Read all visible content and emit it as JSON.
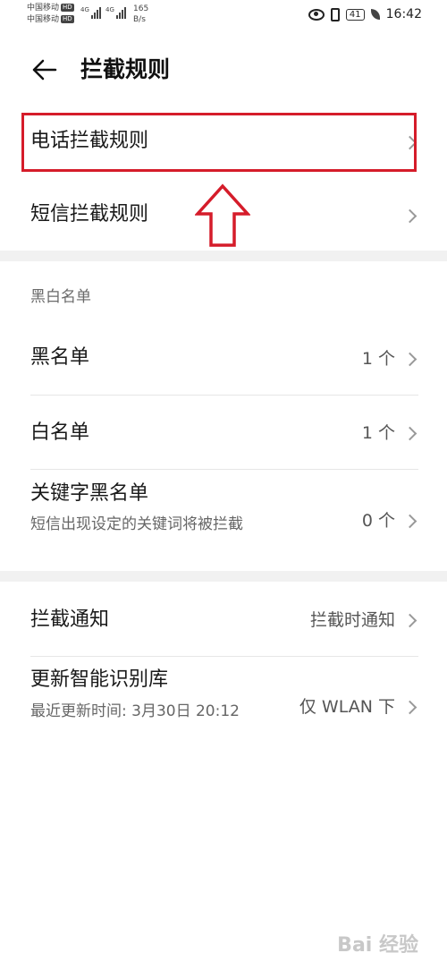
{
  "status_bar": {
    "carrier_1": "中国移动",
    "carrier_2": "中国移动",
    "hd_badge": "HD",
    "network_1": "4G",
    "network_2": "4G",
    "speed_value": "165",
    "speed_unit": "B/s",
    "battery": "41",
    "time": "16:42"
  },
  "header": {
    "title": "拦截规则"
  },
  "rules": {
    "phone_rule": "电话拦截规则",
    "sms_rule": "短信拦截规则"
  },
  "blacklist_section": {
    "header": "黑白名单",
    "blacklist": {
      "label": "黑名单",
      "value": "1 个"
    },
    "whitelist": {
      "label": "白名单",
      "value": "1 个"
    },
    "keyword": {
      "label": "关键字黑名单",
      "sub": "短信出现设定的关键词将被拦截",
      "value": "0 个"
    }
  },
  "other_section": {
    "notify": {
      "label": "拦截通知",
      "value": "拦截时通知"
    },
    "update": {
      "label": "更新智能识别库",
      "sub": "最近更新时间: 3月30日 20:12",
      "value": "仅 WLAN 下"
    }
  },
  "watermark": "Bai 经验",
  "colors": {
    "highlight": "#d51c2a",
    "section_gap": "#f1f1f1"
  }
}
